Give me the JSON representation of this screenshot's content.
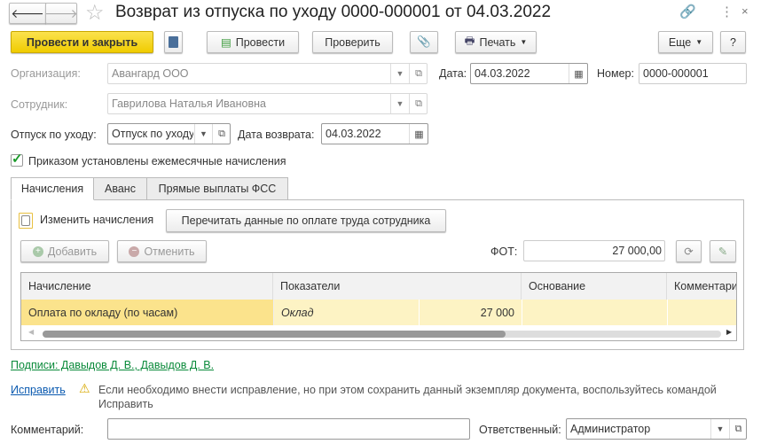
{
  "title": "Возврат из отпуска по уходу 0000-000001 от 04.03.2022",
  "toolbar": {
    "post_close": "Провести и закрыть",
    "post": "Провести",
    "check": "Проверить",
    "print": "Печать",
    "more": "Еще",
    "help": "?"
  },
  "form": {
    "org_label": "Организация:",
    "org_value": "Авангард ООО",
    "date_label": "Дата:",
    "date_value": "04.03.2022",
    "number_label": "Номер:",
    "number_value": "0000-000001",
    "employee_label": "Сотрудник:",
    "employee_value": "Гаврилова Наталья Ивановна",
    "leave_label": "Отпуск по уходу:",
    "leave_value": "Отпуск по уходу",
    "return_label": "Дата возврата:",
    "return_value": "04.03.2022",
    "monthly_label": "Приказом установлены ежемесячные начисления"
  },
  "tabs": [
    "Начисления",
    "Аванс",
    "Прямые выплаты ФСС"
  ],
  "accruals": {
    "change_label": "Изменить начисления",
    "reread": "Перечитать данные по оплате труда сотрудника",
    "add": "Добавить",
    "cancel": "Отменить",
    "fot_label": "ФОТ:",
    "fot_value": "27 000,00",
    "columns": [
      "Начисление",
      "Показатели",
      "Основание",
      "Комментарий"
    ],
    "rows": [
      {
        "accrual": "Оплата по окладу (по часам)",
        "indicator": "Оклад",
        "amount": "27 000",
        "basis": "",
        "comment": ""
      }
    ]
  },
  "signatures": "Подписи: Давыдов Д. В., Давыдов Д. В.",
  "fix_link": "Исправить",
  "fix_note": "Если необходимо внести исправление, но при этом сохранить данный экземпляр документа, воспользуйтесь командой",
  "fix_note2": "Исправить",
  "comment_label": "Комментарий:",
  "comment_value": "",
  "responsible_label": "Ответственный:",
  "responsible_value": "Администратор",
  "colors": {
    "accent": "#f5d20f",
    "link": "#0b5ab0",
    "signature": "#0a8a3a"
  }
}
